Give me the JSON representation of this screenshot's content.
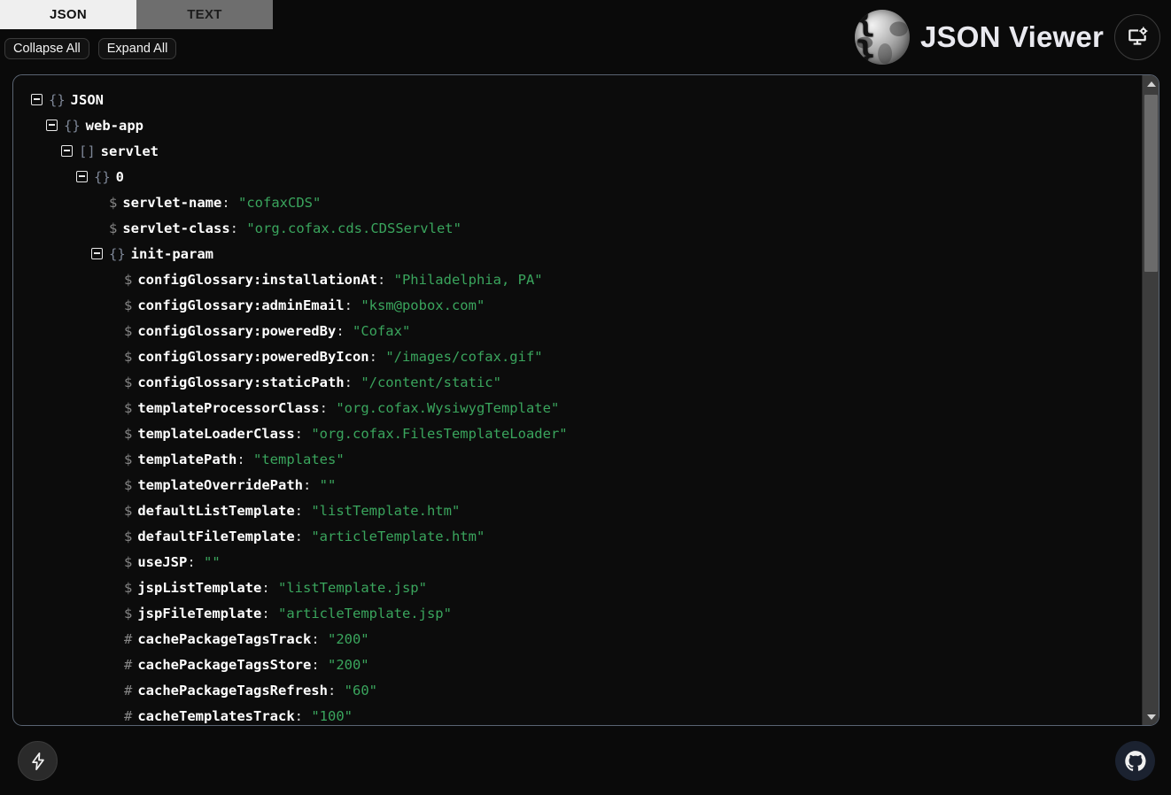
{
  "header": {
    "brand_title": "JSON Viewer",
    "logo_braces": "{ }",
    "logo_icon": "json-sphere-logo",
    "display_settings_icon": "monitor-gear-icon"
  },
  "tabs": [
    {
      "label": "JSON",
      "active": true
    },
    {
      "label": "TEXT",
      "active": false
    }
  ],
  "actions": {
    "collapse_all": "Collapse All",
    "expand_all": "Expand All"
  },
  "scrollbar": {
    "up_arrow_icon": "chevron-up-icon",
    "down_arrow_icon": "chevron-down-icon"
  },
  "footer": {
    "bolt_icon": "lightning-bolt-icon",
    "github_icon": "github-icon"
  },
  "colors": {
    "page_bg": "#0a0a0a",
    "panel_bg": "#0c0c0c",
    "panel_border": "#5a6472",
    "key_text": "#ffffff",
    "value_text": "#3aa55d",
    "symbol_text": "#7d8696",
    "tab_active_bg": "#efefef",
    "tab_inactive_bg": "#6e6e6e",
    "scrollbar_track": "#3d3d3d",
    "scrollbar_thumb": "#6b6b6b",
    "github_bg": "#1b2230"
  },
  "tree": {
    "rows": [
      {
        "indent": 0,
        "toggle": true,
        "sym": "{}",
        "key": "JSON",
        "value": null
      },
      {
        "indent": 1,
        "toggle": true,
        "sym": "{}",
        "key": "web-app",
        "value": null
      },
      {
        "indent": 2,
        "toggle": true,
        "sym": "[]",
        "key": "servlet",
        "value": null
      },
      {
        "indent": 3,
        "toggle": true,
        "sym": "{}",
        "key": "0",
        "value": null
      },
      {
        "indent": 4,
        "toggle": false,
        "sym": "$",
        "key": "servlet-name",
        "value": "\"cofaxCDS\""
      },
      {
        "indent": 4,
        "toggle": false,
        "sym": "$",
        "key": "servlet-class",
        "value": "\"org.cofax.cds.CDSServlet\""
      },
      {
        "indent": 4,
        "toggle": true,
        "sym": "{}",
        "key": "init-param",
        "value": null
      },
      {
        "indent": 5,
        "toggle": false,
        "sym": "$",
        "key": "configGlossary:installationAt",
        "value": "\"Philadelphia, PA\""
      },
      {
        "indent": 5,
        "toggle": false,
        "sym": "$",
        "key": "configGlossary:adminEmail",
        "value": "\"ksm@pobox.com\""
      },
      {
        "indent": 5,
        "toggle": false,
        "sym": "$",
        "key": "configGlossary:poweredBy",
        "value": "\"Cofax\""
      },
      {
        "indent": 5,
        "toggle": false,
        "sym": "$",
        "key": "configGlossary:poweredByIcon",
        "value": "\"/images/cofax.gif\""
      },
      {
        "indent": 5,
        "toggle": false,
        "sym": "$",
        "key": "configGlossary:staticPath",
        "value": "\"/content/static\""
      },
      {
        "indent": 5,
        "toggle": false,
        "sym": "$",
        "key": "templateProcessorClass",
        "value": "\"org.cofax.WysiwygTemplate\""
      },
      {
        "indent": 5,
        "toggle": false,
        "sym": "$",
        "key": "templateLoaderClass",
        "value": "\"org.cofax.FilesTemplateLoader\""
      },
      {
        "indent": 5,
        "toggle": false,
        "sym": "$",
        "key": "templatePath",
        "value": "\"templates\""
      },
      {
        "indent": 5,
        "toggle": false,
        "sym": "$",
        "key": "templateOverridePath",
        "value": "\"\""
      },
      {
        "indent": 5,
        "toggle": false,
        "sym": "$",
        "key": "defaultListTemplate",
        "value": "\"listTemplate.htm\""
      },
      {
        "indent": 5,
        "toggle": false,
        "sym": "$",
        "key": "defaultFileTemplate",
        "value": "\"articleTemplate.htm\""
      },
      {
        "indent": 5,
        "toggle": false,
        "sym": "$",
        "key": "useJSP",
        "value": "\"\""
      },
      {
        "indent": 5,
        "toggle": false,
        "sym": "$",
        "key": "jspListTemplate",
        "value": "\"listTemplate.jsp\""
      },
      {
        "indent": 5,
        "toggle": false,
        "sym": "$",
        "key": "jspFileTemplate",
        "value": "\"articleTemplate.jsp\""
      },
      {
        "indent": 5,
        "toggle": false,
        "sym": "#",
        "key": "cachePackageTagsTrack",
        "value": "\"200\""
      },
      {
        "indent": 5,
        "toggle": false,
        "sym": "#",
        "key": "cachePackageTagsStore",
        "value": "\"200\""
      },
      {
        "indent": 5,
        "toggle": false,
        "sym": "#",
        "key": "cachePackageTagsRefresh",
        "value": "\"60\""
      },
      {
        "indent": 5,
        "toggle": false,
        "sym": "#",
        "key": "cacheTemplatesTrack",
        "value": "\"100\""
      }
    ]
  }
}
